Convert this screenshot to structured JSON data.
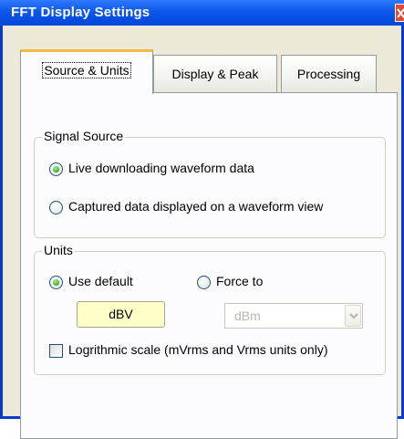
{
  "window": {
    "title": "FFT Display Settings"
  },
  "tabs": [
    {
      "label": "Source & Units",
      "active": true
    },
    {
      "label": "Display & Peak",
      "active": false
    },
    {
      "label": "Processing",
      "active": false
    }
  ],
  "signal_source": {
    "legend": "Signal Source",
    "options": [
      {
        "label": "Live downloading waveform data",
        "selected": true
      },
      {
        "label": "Captured data displayed on a waveform view",
        "selected": false
      }
    ]
  },
  "units": {
    "legend": "Units",
    "use_default_label": "Use default",
    "use_default_selected": true,
    "force_to_label": "Force to",
    "force_to_selected": false,
    "default_value": "dBV",
    "force_value": "dBm",
    "log_scale_label": "Logrithmic scale (mVrms and Vrms units only)",
    "log_scale_checked": false
  },
  "colors": {
    "title_bar": "#0c57ea",
    "active_tab_accent": "#f5b945",
    "radio_selected": "#44b52a",
    "default_value_background": "#ffffc8"
  }
}
